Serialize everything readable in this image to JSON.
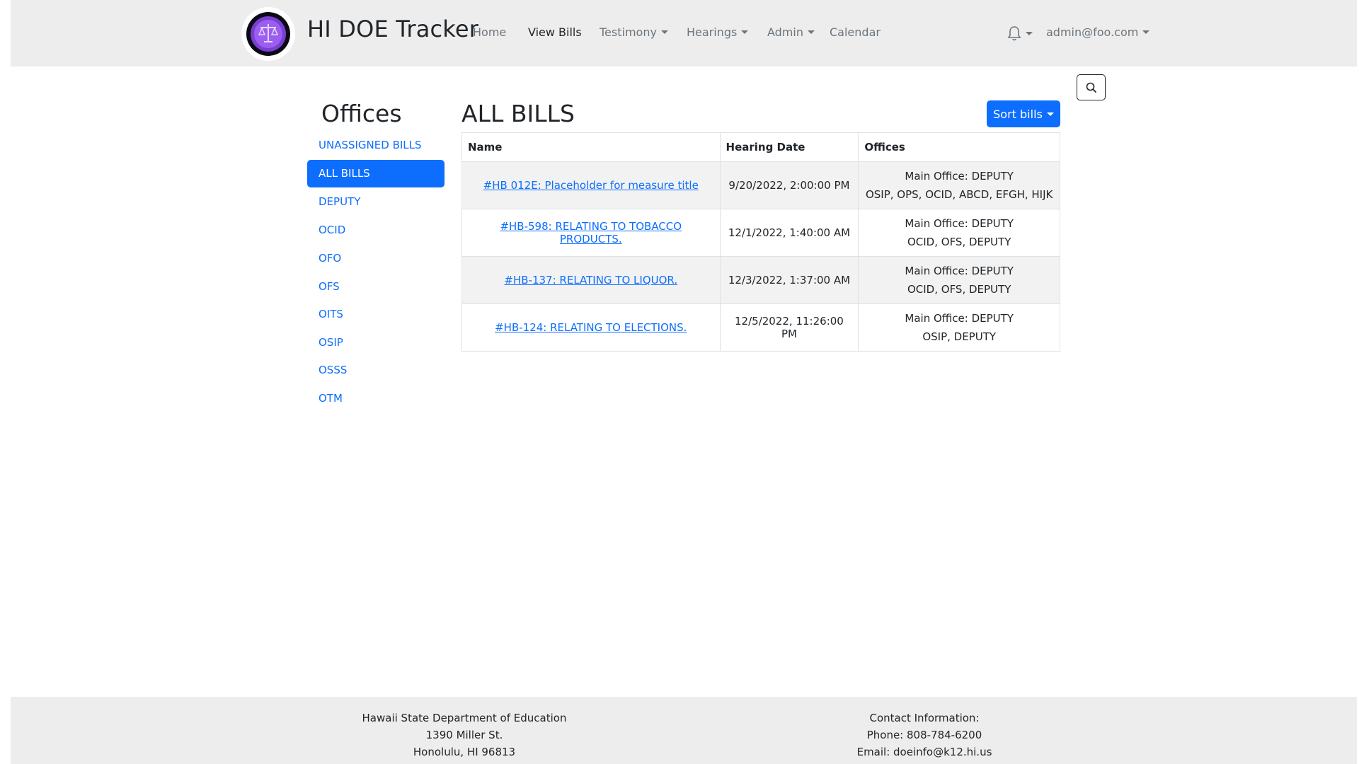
{
  "navbar": {
    "brand": "HI DOE Tracker",
    "links": {
      "home": "Home",
      "view_bills": "View Bills",
      "testimony": "Testimony",
      "hearings": "Hearings",
      "admin": "Admin",
      "calendar": "Calendar"
    },
    "user": "admin@foo.com"
  },
  "sidebar": {
    "title": "Offices",
    "items": [
      {
        "label": "UNASSIGNED BILLS",
        "active": false
      },
      {
        "label": "ALL BILLS",
        "active": true
      },
      {
        "label": "DEPUTY",
        "active": false
      },
      {
        "label": "OCID",
        "active": false
      },
      {
        "label": "OFO",
        "active": false
      },
      {
        "label": "OFS",
        "active": false
      },
      {
        "label": "OITS",
        "active": false
      },
      {
        "label": "OSIP",
        "active": false
      },
      {
        "label": "OSSS",
        "active": false
      },
      {
        "label": "OTM",
        "active": false
      }
    ]
  },
  "main": {
    "title": "ALL BILLS",
    "sort_label": "Sort bills",
    "table": {
      "headers": [
        "Name",
        "Hearing Date",
        "Offices"
      ],
      "rows": [
        {
          "name": "#HB 012E: Placeholder for measure title",
          "date": "9/20/2022, 2:00:00 PM",
          "main_office": "Main Office: DEPUTY",
          "offices": "OSIP, OPS, OCID, ABCD, EFGH, HIJK"
        },
        {
          "name": "#HB-598: RELATING TO TOBACCO PRODUCTS.",
          "date": "12/1/2022, 1:40:00 AM",
          "main_office": "Main Office: DEPUTY",
          "offices": "OCID, OFS, DEPUTY"
        },
        {
          "name": "#HB-137: RELATING TO LIQUOR.",
          "date": "12/3/2022, 1:37:00 AM",
          "main_office": "Main Office: DEPUTY",
          "offices": "OCID, OFS, DEPUTY"
        },
        {
          "name": "#HB-124: RELATING TO ELECTIONS.",
          "date": "12/5/2022, 11:26:00 PM",
          "main_office": "Main Office: DEPUTY",
          "offices": "OSIP, DEPUTY"
        }
      ]
    }
  },
  "footer": {
    "left": [
      "Hawaii State Department of Education",
      "1390 Miller St.",
      "Honolulu, HI 96813"
    ],
    "right": [
      "Contact Information:",
      "Phone: 808-784-6200",
      "Email: doeinfo@k12.hi.us"
    ]
  },
  "colors": {
    "primary": "#0d6efd",
    "navbar_bg": "#ededed",
    "stripe": "#f2f2f2"
  },
  "icons": {
    "logo": "scales-of-justice-logo",
    "bell": "bell-icon",
    "search": "search-icon",
    "caret": "caret-down-icon"
  }
}
